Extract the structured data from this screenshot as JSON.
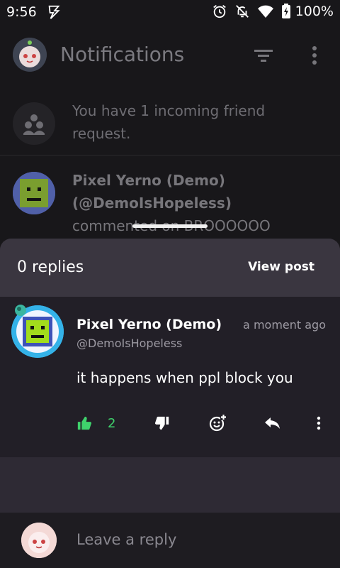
{
  "status_bar": {
    "time": "9:56",
    "battery": "100%",
    "icons": [
      "bolt-icon",
      "alarm-icon",
      "notifications-off-icon",
      "wifi-icon",
      "battery-charging-icon"
    ]
  },
  "app_bar": {
    "title": "Notifications",
    "filter_icon": "filter-icon",
    "more_icon": "more-vert-icon"
  },
  "friend_request": {
    "text": "You have 1 incoming friend request.",
    "icon": "group-icon"
  },
  "notification": {
    "name": "Pixel Yerno (Demo)",
    "handle": "(@DemoIsHopeless)",
    "action": "commented on BROOOOOO"
  },
  "sheet": {
    "replies_label": "0 replies",
    "view_post_label": "View post"
  },
  "comment": {
    "author": "Pixel Yerno (Demo)",
    "handle": "@DemoIsHopeless",
    "time": "a moment ago",
    "body": "it happens when ppl block you",
    "likes": "2"
  },
  "reply_bar": {
    "placeholder": "Leave a reply"
  },
  "colors": {
    "background": "#18171a",
    "sheet": "#2e2a34",
    "sheet_header": "#3a3640",
    "comment_bg": "#221f27",
    "like_green": "#3fd26c"
  }
}
